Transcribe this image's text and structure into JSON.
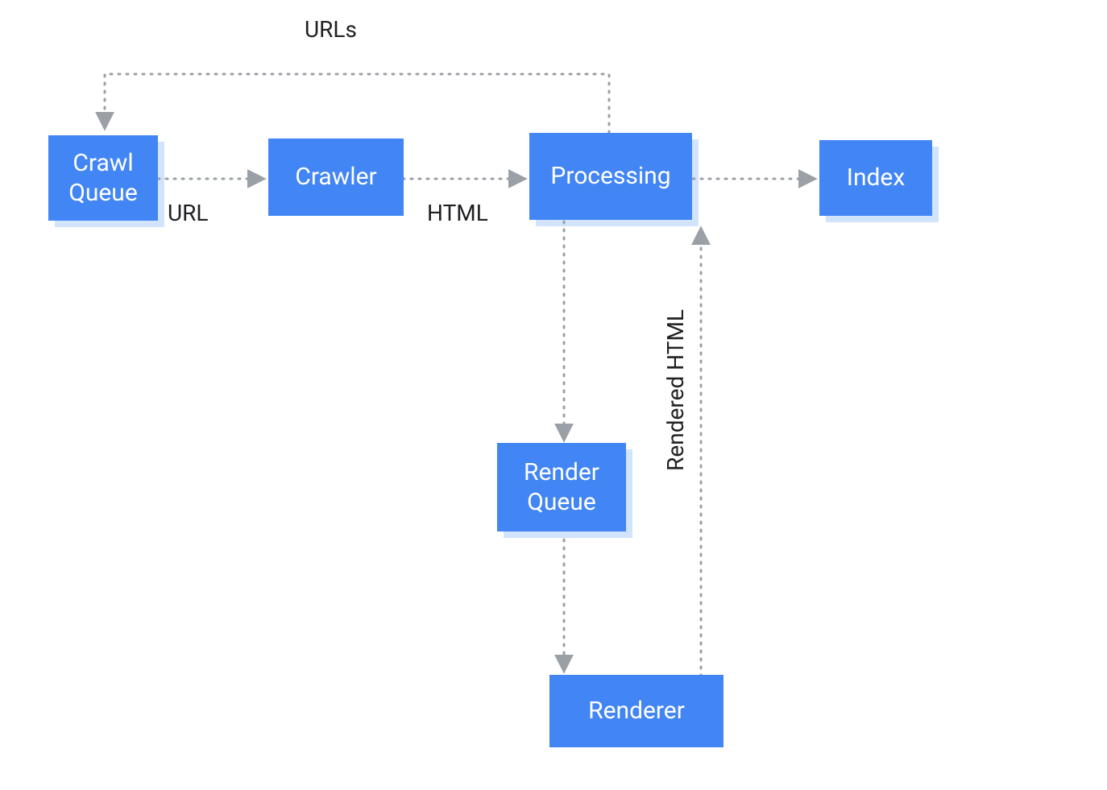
{
  "nodes": {
    "crawl_queue": "Crawl\nQueue",
    "crawler": "Crawler",
    "processing": "Processing",
    "index": "Index",
    "render_queue": "Render\nQueue",
    "renderer": "Renderer"
  },
  "edges": {
    "urls": "URLs",
    "url": "URL",
    "html": "HTML",
    "rendered_html": "Rendered HTML"
  },
  "colors": {
    "node_bg": "#4285F4",
    "node_shadow": "#D2E3FC",
    "node_text": "#ffffff",
    "edge_line": "#9AA0A6",
    "edge_label": "#202124"
  }
}
